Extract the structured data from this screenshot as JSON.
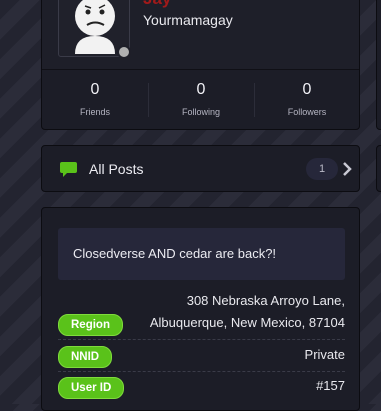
{
  "profile": {
    "name": "Jay",
    "username": "Yourmamagay",
    "stats": [
      {
        "value": "0",
        "label": "Friends"
      },
      {
        "value": "0",
        "label": "Following"
      },
      {
        "value": "0",
        "label": "Followers"
      }
    ]
  },
  "all_posts": {
    "label": "All Posts",
    "count": "1"
  },
  "info": {
    "bio": "Closedverse AND cedar are back?!",
    "region_label": "Region",
    "region_value_line1": "308 Nebraska Arroyo Lane,",
    "region_value_line2": "Albuquerque, New Mexico, 87104",
    "nnid_label": "NNID",
    "nnid_value": "Private",
    "userid_label": "User ID",
    "userid_value": "#157"
  },
  "colors": {
    "accent_green": "#5ac21a",
    "name_red": "#a01a1a",
    "card_bg": "#1c1d27"
  },
  "icons": {
    "avatar": "confused-face-icon",
    "posts": "chat-bubble-icon",
    "more": "chevron-right-icon"
  }
}
